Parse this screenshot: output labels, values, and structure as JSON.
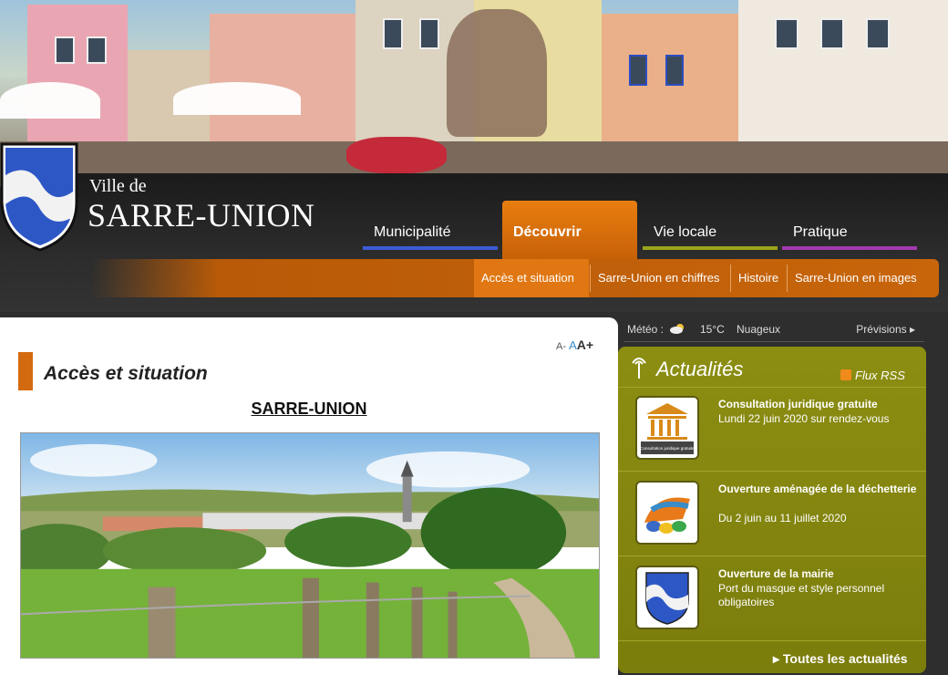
{
  "brand": {
    "small": "Ville de",
    "big": "SARRE-UNION"
  },
  "nav": {
    "tabs": [
      {
        "label": "Municipalité",
        "color": "#3b5bd6"
      },
      {
        "label": "Découvrir",
        "color": "#e97e10"
      },
      {
        "label": "Vie locale",
        "color": "#9aa51a"
      },
      {
        "label": "Pratique",
        "color": "#a23ab0"
      }
    ],
    "subtabs": [
      {
        "label": "Accès et situation"
      },
      {
        "label": "Sarre-Union en chiffres"
      },
      {
        "label": "Histoire"
      },
      {
        "label": "Sarre-Union en images"
      }
    ]
  },
  "main": {
    "font_controls": {
      "small": "A-",
      "medium": "A",
      "large": "A+"
    },
    "title": "Accès et situation",
    "subtitle": "SARRE-UNION"
  },
  "meteo": {
    "label": "Météo :",
    "temperature": "15°C",
    "condition": "Nuageux",
    "forecast_link": "Prévisions ▸"
  },
  "news": {
    "title": "Actualités",
    "rss": "Flux RSS",
    "items": [
      {
        "title": "Consultation juridique gratuite",
        "desc": "Lundi 22 juin 2020 sur rendez-vous",
        "thumb_caption": "Consultation juridique gratuite"
      },
      {
        "title": "Ouverture aménagée de la déchetterie",
        "desc": "Du 2 juin au 11 juillet 2020"
      },
      {
        "title": "Ouverture de la mairie",
        "desc": "Port du masque et style personnel obligatoires"
      }
    ],
    "all_link": "▸ Toutes les actualités"
  }
}
